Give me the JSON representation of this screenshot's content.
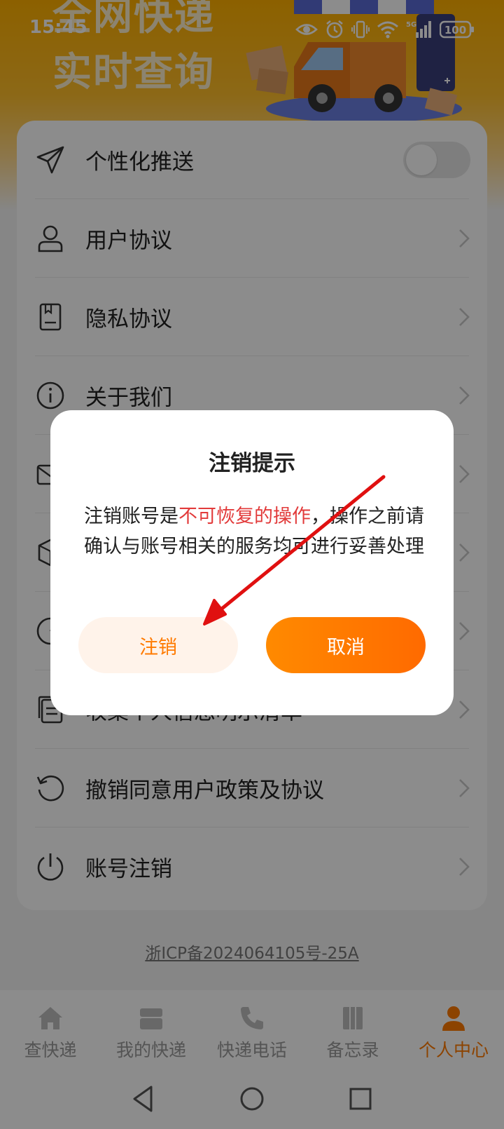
{
  "status_bar": {
    "time": "15:45",
    "network": "5G",
    "battery": "100"
  },
  "banner": {
    "line1": "全网快递",
    "line2": "实时查询"
  },
  "settings": {
    "items": [
      {
        "label": "个性化推送",
        "icon": "send-icon",
        "control": "toggle",
        "toggle_on": false
      },
      {
        "label": "用户协议",
        "icon": "user-icon",
        "control": "chevron"
      },
      {
        "label": "隐私协议",
        "icon": "document-icon",
        "control": "chevron"
      },
      {
        "label": "关于我们",
        "icon": "info-icon",
        "control": "chevron"
      },
      {
        "label": "",
        "icon": "mail-icon",
        "control": "chevron"
      },
      {
        "label": "",
        "icon": "box-icon",
        "control": "chevron"
      },
      {
        "label": "",
        "icon": "gauge-icon",
        "control": "chevron"
      },
      {
        "label": "收集个人信息明示清单",
        "icon": "list-doc-icon",
        "control": "chevron"
      },
      {
        "label": "撤销同意用户政策及协议",
        "icon": "revoke-icon",
        "control": "chevron"
      },
      {
        "label": "账号注销",
        "icon": "power-icon",
        "control": "chevron"
      }
    ]
  },
  "footer": {
    "icp": "浙ICP备2024064105号-25A"
  },
  "tabbar": {
    "active_color": "#ff7a00",
    "tabs": [
      {
        "label": "查快递",
        "icon": "home-icon"
      },
      {
        "label": "我的快递",
        "icon": "package-icon"
      },
      {
        "label": "快递电话",
        "icon": "phone-icon"
      },
      {
        "label": "备忘录",
        "icon": "notebook-icon"
      },
      {
        "label": "个人中心",
        "icon": "person-icon",
        "active": true
      }
    ]
  },
  "dialog": {
    "title": "注销提示",
    "message_prefix": "注销账号是",
    "message_warning": "不可恢复的操作",
    "message_suffix": "，操作之前请确认与账号相关的服务均可进行妥善处理",
    "confirm_label": "注销",
    "cancel_label": "取消"
  },
  "annotation": {
    "arrow_color": "#e01010"
  }
}
